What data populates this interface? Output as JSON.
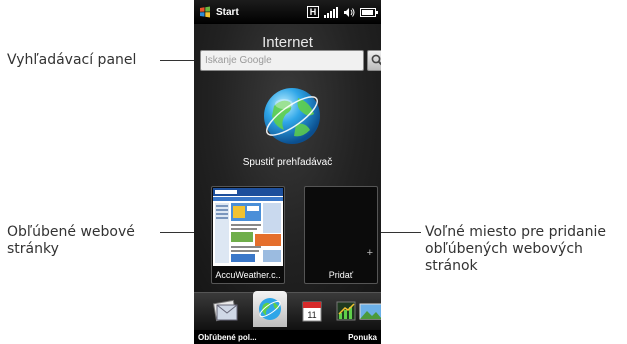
{
  "callouts": {
    "search_panel": "Vyhľadávací panel",
    "favorites_line1": "Obľúbené webové",
    "favorites_line2": "stránky",
    "free_space_line1": "Voľné miesto pre pridanie",
    "free_space_line2": "obľúbených webových",
    "free_space_line3": "stránok"
  },
  "status_bar": {
    "start_label": "Start",
    "network_letter": "H",
    "icons": [
      "windows-flag-icon",
      "h-network-icon",
      "signal-icon",
      "speaker-icon",
      "battery-icon"
    ]
  },
  "internet": {
    "title": "Internet",
    "search_placeholder": "Iskanje Google",
    "launch_label": "Spustiť prehľadávač",
    "favorite_tile_label": "AccuWeather.c..",
    "add_tile_label": "Pridať",
    "add_symbol": "+"
  },
  "tabbar": {
    "tabs": [
      "mail-tab",
      "internet-tab",
      "calendar-tab",
      "stocks-tab",
      "photos-tab"
    ],
    "calendar_day": "11"
  },
  "softkeys": {
    "left": "Obľúbené pol...",
    "right": "Ponuka"
  }
}
